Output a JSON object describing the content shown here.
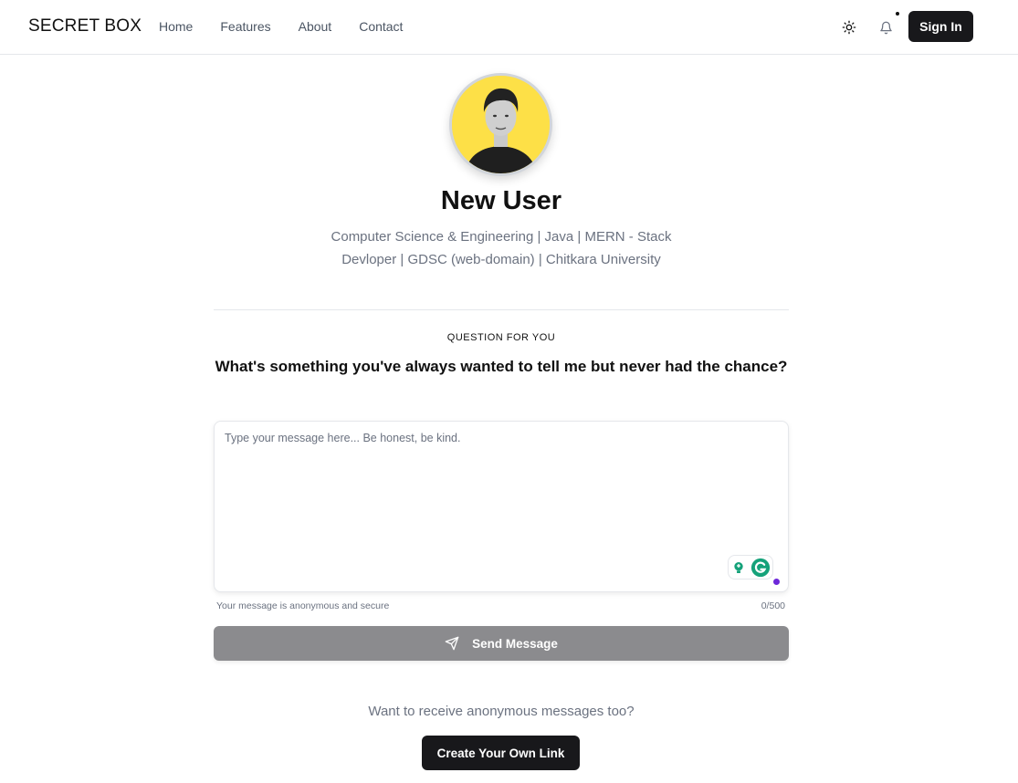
{
  "header": {
    "logo": "SECRET BOX",
    "nav": [
      {
        "label": "Home"
      },
      {
        "label": "Features"
      },
      {
        "label": "About"
      },
      {
        "label": "Contact"
      }
    ],
    "sign_in_label": "Sign In",
    "icons": [
      "sun-icon",
      "bell-icon"
    ]
  },
  "profile": {
    "name": "New User",
    "bio_line1": "Computer Science & Engineering | Java | MERN - Stack",
    "bio_line2": "Devloper | GDSC (web-domain) | Chitkara University"
  },
  "question": {
    "label": "QUESTION FOR YOU",
    "text": "What's something you've always wanted to tell me but never had the chance?"
  },
  "message": {
    "placeholder": "Type your message here... Be honest, be kind.",
    "value": "",
    "note": "Your message is anonymous and secure",
    "counter": "0/500",
    "send_label": "Send Message"
  },
  "cta": {
    "text": "Want to receive anonymous messages too?",
    "button_label": "Create Your Own Link"
  },
  "colors": {
    "primary_dark": "#18181b",
    "disabled_button": "#8b8b8e",
    "muted_text": "#6b7280",
    "avatar_bg": "#fde047",
    "grammarly_green": "#15a27a"
  }
}
